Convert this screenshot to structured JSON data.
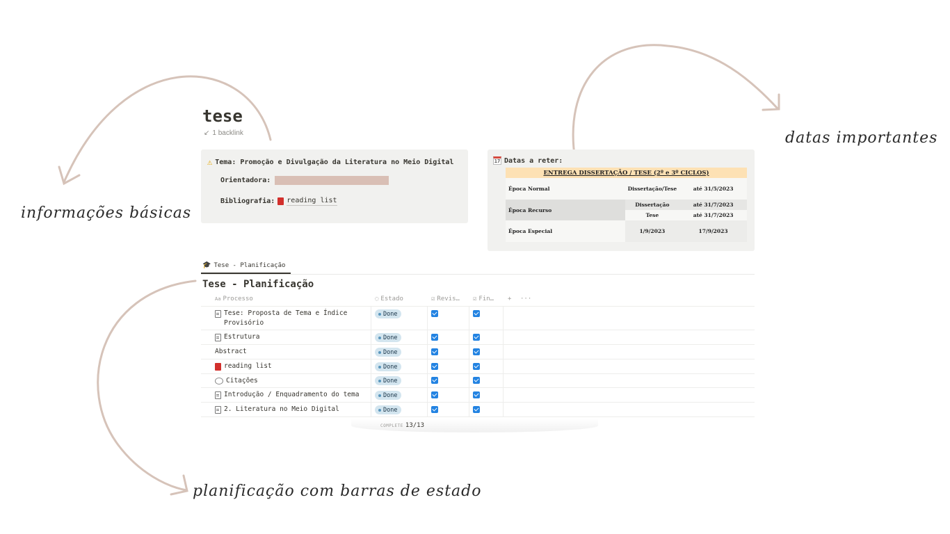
{
  "annotations": {
    "basic_info": "informações básicas",
    "important_dates": "datas importantes",
    "planning": "planificação com barras de estado"
  },
  "page": {
    "title": "tese",
    "backlink": "1 backlink"
  },
  "info_callout": {
    "icon": "warning-icon",
    "theme": "Tema: Promoção e Divulgação da Literatura no Meio Digital",
    "advisor_label": "Orientadora:",
    "bibliography_label": "Bibliografia:",
    "bibliography_link": "reading list"
  },
  "dates_callout": {
    "icon": "calendar-icon",
    "calendar_day": "17",
    "title": "Datas a reter:",
    "table": {
      "header": "ENTREGA DISSERTAÇÃO / TESE (2º e 3º CICLOS)",
      "rows": [
        {
          "epoca": "Época Normal",
          "tipo": "Dissertação/Tese",
          "data": "até 31/5/2023"
        },
        {
          "epoca": "Época Recurso",
          "tipo": "Dissertação",
          "data": "até 31/7/2023"
        },
        {
          "tipo": "Tese",
          "data": "até 31/7/2023"
        },
        {
          "epoca": "Época Especial",
          "tipo": "1/9/2023",
          "data": "17/9/2023"
        }
      ]
    },
    "header_color": "#fde1b4"
  },
  "database": {
    "tab_label": "Tese - Planificação",
    "title": "Tese - Planificação",
    "columns": [
      "Processo",
      "Estado",
      "Revis…",
      "Fin…"
    ],
    "add_symbol": "+",
    "more_symbol": "···",
    "rows": [
      {
        "name": "Tese: Proposta de Tema e Índice Provisório",
        "icon": "doc-icon",
        "status": "Done",
        "revisto": true,
        "final": true
      },
      {
        "name": "Estrutura",
        "icon": "doc-icon",
        "status": "Done",
        "revisto": true,
        "final": true
      },
      {
        "name": "Abstract",
        "icon": "",
        "status": "Done",
        "revisto": true,
        "final": true
      },
      {
        "name": "reading list",
        "icon": "book-icon",
        "status": "Done",
        "revisto": true,
        "final": true
      },
      {
        "name": "Citações",
        "icon": "speech-bubble-icon",
        "status": "Done",
        "revisto": true,
        "final": true
      },
      {
        "name": "Introdução / Enquadramento do tema",
        "icon": "doc-icon",
        "status": "Done",
        "revisto": true,
        "final": true
      },
      {
        "name": "2. Literatura no Meio Digital",
        "icon": "doc-icon",
        "status": "Done",
        "revisto": true,
        "final": true
      }
    ],
    "footer_label": "COMPLETE",
    "footer_value": "13/13",
    "status_color": "#d3e5ef",
    "check_color": "#2383e2"
  },
  "colors": {
    "arrow": "#d6c3b9",
    "callout_bg": "#f1f1ef",
    "redaction": "#d9bfb5"
  }
}
